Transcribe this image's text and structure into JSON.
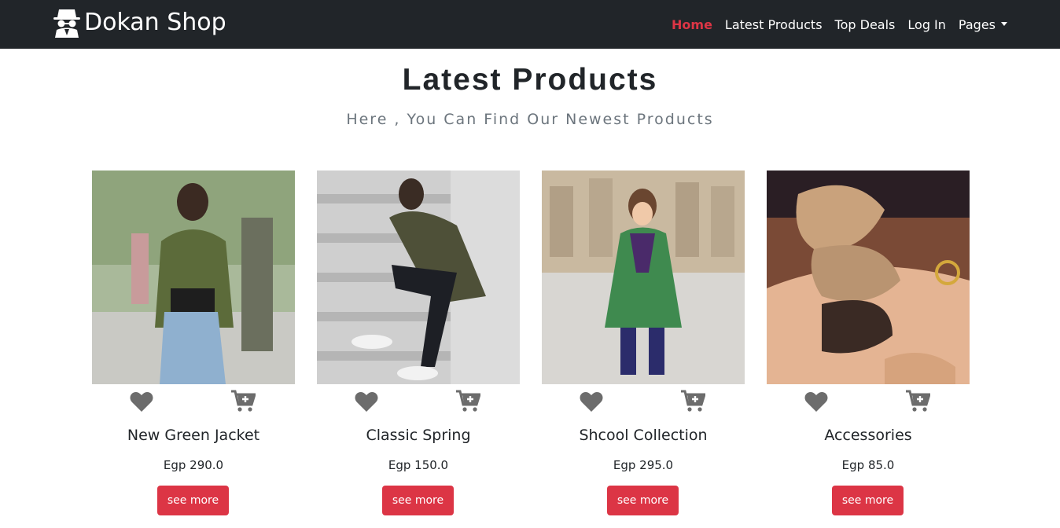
{
  "brand": {
    "name": "Dokan Shop",
    "logo_icon": "incognito-spy-icon"
  },
  "nav": [
    {
      "label": "Home",
      "active": true
    },
    {
      "label": "Latest Products",
      "active": false
    },
    {
      "label": "Top Deals",
      "active": false
    },
    {
      "label": "Log In",
      "active": false
    },
    {
      "label": "Pages",
      "active": false,
      "dropdown": true
    }
  ],
  "section": {
    "title": "Latest Products",
    "subtitle": "Here , You Can Find Our Newest Products"
  },
  "colors": {
    "navbar_bg": "#212529",
    "accent": "#dc3545",
    "icon_gray": "#6c6c6c"
  },
  "products": [
    {
      "name": "New Green Jacket",
      "price": "Egp 290.0",
      "button": "see more",
      "wishlist_icon": "heart-icon",
      "cart_icon": "cart-plus-icon"
    },
    {
      "name": "Classic Spring",
      "price": "Egp 150.0",
      "button": "see more",
      "wishlist_icon": "heart-icon",
      "cart_icon": "cart-plus-icon"
    },
    {
      "name": "Shcool Collection",
      "price": "Egp 295.0",
      "button": "see more",
      "wishlist_icon": "heart-icon",
      "cart_icon": "cart-plus-icon"
    },
    {
      "name": "Accessories",
      "price": "Egp 85.0",
      "button": "see more",
      "wishlist_icon": "heart-icon",
      "cart_icon": "cart-plus-icon"
    }
  ]
}
